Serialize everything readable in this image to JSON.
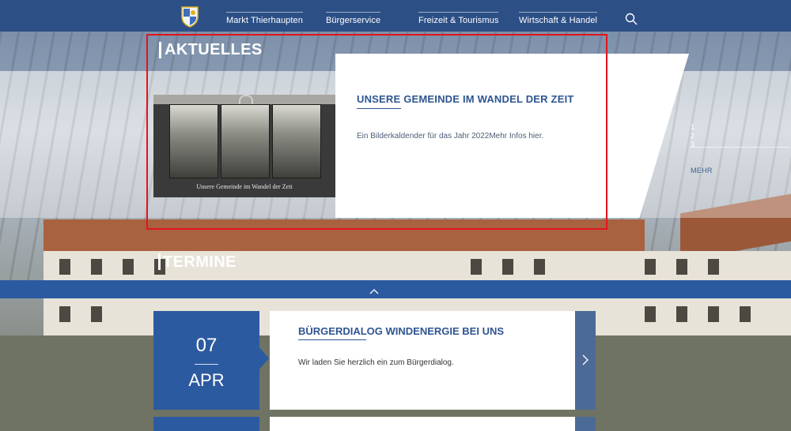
{
  "nav": {
    "items": [
      {
        "label": "Markt Thierhaupten"
      },
      {
        "label": "Bürgerservice"
      },
      {
        "label": "Freizeit & Tourismus"
      },
      {
        "label": "Wirtschaft & Handel"
      }
    ],
    "search_icon": "search-icon",
    "logo_icon": "coat-of-arms-icon"
  },
  "aktuelles": {
    "heading": "AKTUELLES",
    "image_caption": "Unsere Gemeinde im Wandel der Zeit",
    "card_title": "UNSERE GEMEINDE IM WANDEL DER ZEIT",
    "card_text": "Ein Bilderkaldender für das Jahr 2022Mehr Infos hier.",
    "pager": [
      "1",
      "2",
      "3"
    ],
    "more_label": "MEHR"
  },
  "termine": {
    "heading": "TERMINE",
    "collapse_icon": "chevron-up-icon",
    "event": {
      "day": "07",
      "month": "APR",
      "title": "BÜRGERDIALOG WINDENERGIE BEI UNS",
      "text": "Wir laden Sie herzlich ein zum Bürgerdialog.",
      "next_icon": "chevron-right-icon"
    }
  },
  "colors": {
    "brand_blue": "#2c5aa0",
    "nav_blue": "#2c4f86",
    "highlight_red": "#e3141d"
  }
}
